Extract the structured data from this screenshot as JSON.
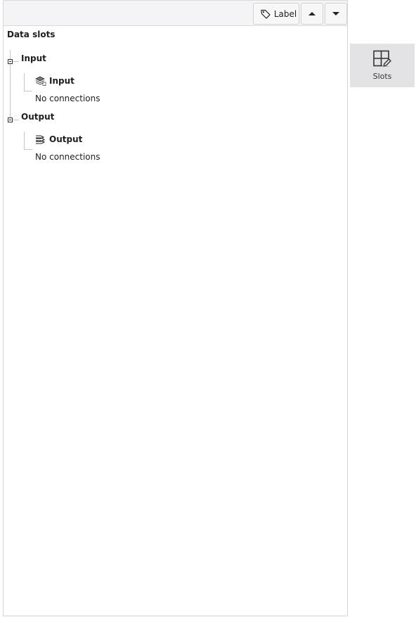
{
  "toolbar": {
    "label_button": "Label",
    "label_icon": "tag-icon",
    "move_up_icon": "triangle-up-icon",
    "move_down_icon": "triangle-down-icon"
  },
  "tree": {
    "root_title": "Data slots",
    "groups": [
      {
        "title": "Input",
        "slot": {
          "name": "Input",
          "icon": "stacked-layers-icon"
        },
        "status": "No connections"
      },
      {
        "title": "Output",
        "slot": {
          "name": "Output",
          "icon": "stacked-arrows-icon"
        },
        "status": "No connections"
      }
    ]
  },
  "side_tab": {
    "label": "Slots",
    "icon": "grid-edit-icon"
  }
}
